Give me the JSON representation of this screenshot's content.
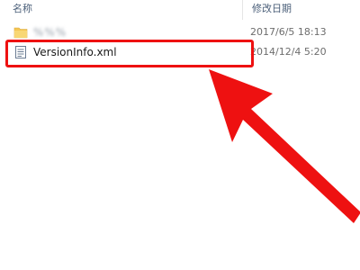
{
  "columns": {
    "name": "名称",
    "date_modified": "修改日期"
  },
  "rows": [
    {
      "icon": "folder-icon",
      "name": "%%%",
      "date_modified": "2017/6/5 18:13"
    },
    {
      "icon": "xml-file-icon",
      "name": "VersionInfo.xml",
      "date_modified": "2014/12/4 5:20"
    }
  ],
  "colors": {
    "highlight": "#ee1111",
    "arrow": "#ee1111",
    "folder": "#f4c653",
    "header_text": "#4c607a"
  }
}
